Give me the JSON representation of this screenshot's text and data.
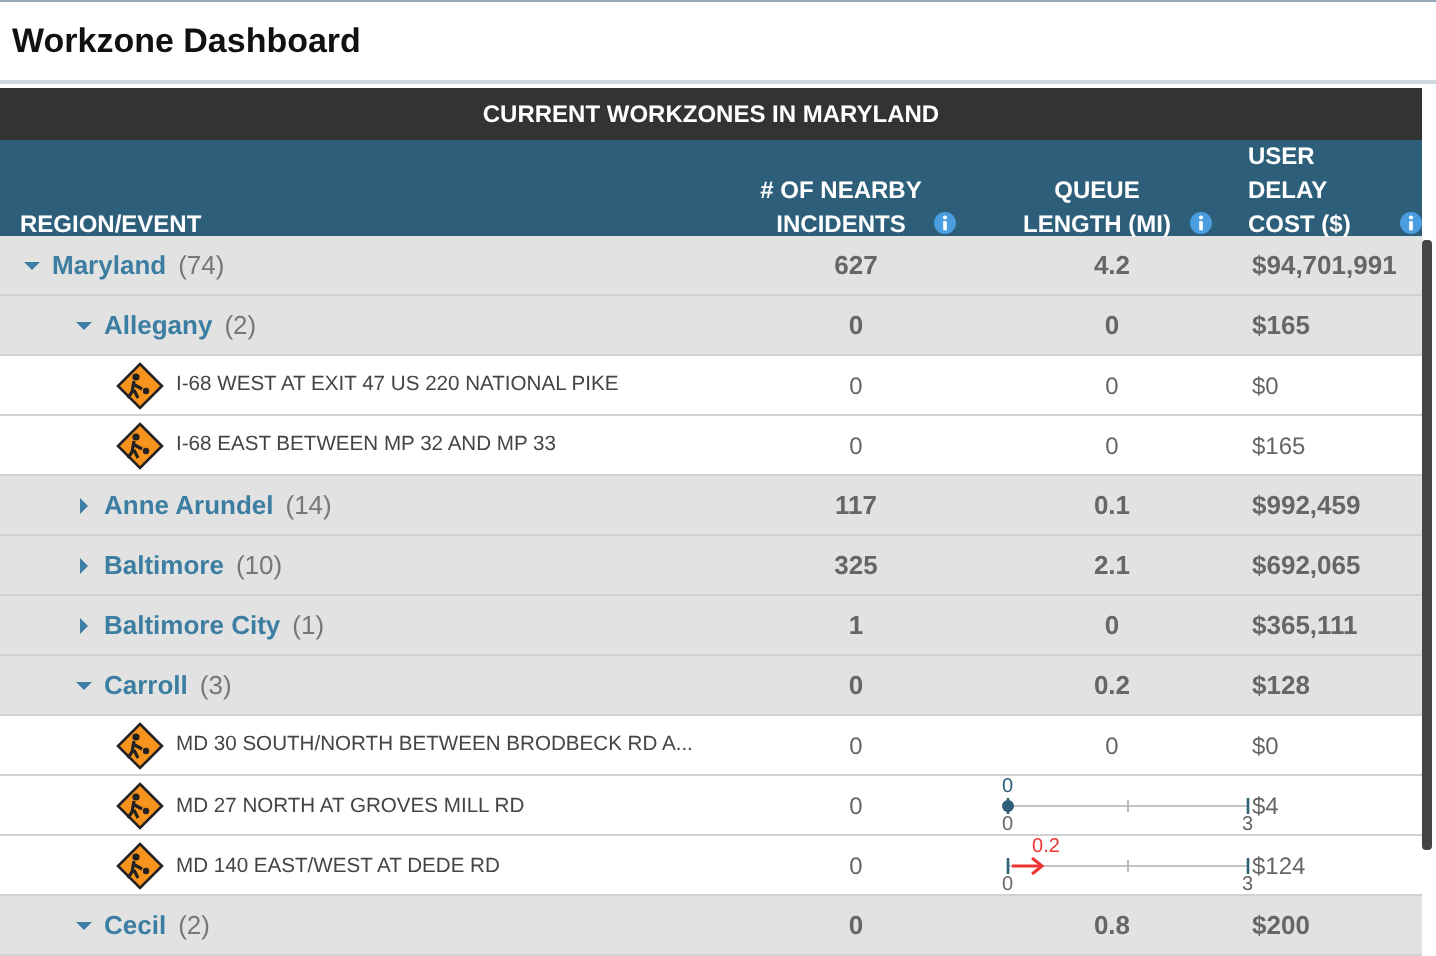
{
  "app_title": "Workzone Dashboard",
  "table": {
    "title": "CURRENT WORKZONES IN MARYLAND",
    "columns": [
      {
        "label": "REGION/EVENT",
        "info": false
      },
      {
        "label": "# OF NEARBY INCIDENTS",
        "info": true
      },
      {
        "label": "QUEUE LENGTH (MI)",
        "info": true
      },
      {
        "label": "USER DELAY COST ($)",
        "info": true
      }
    ],
    "rows": [
      {
        "kind": "region",
        "name": "Maryland",
        "count": "(74)",
        "expanded": true,
        "incidents": "627",
        "queue": {
          "kind": "text",
          "text": "4.2"
        },
        "cost": "$94,701,991",
        "children": [
          {
            "kind": "region",
            "name": "Allegany",
            "count": "(2)",
            "expanded": true,
            "incidents": "0",
            "queue": {
              "kind": "text",
              "text": "0"
            },
            "cost": "$165",
            "children": [
              {
                "kind": "event",
                "name": "I-68 WEST AT EXIT 47 US 220 NATIONAL PIKE",
                "incidents": "0",
                "queue": {
                  "kind": "text",
                  "text": "0"
                },
                "cost": "$0"
              },
              {
                "kind": "event",
                "name": "I-68 EAST BETWEEN MP 32 AND MP 33",
                "incidents": "0",
                "queue": {
                  "kind": "text",
                  "text": "0"
                },
                "cost": "$165"
              }
            ]
          },
          {
            "kind": "region",
            "name": "Anne Arundel",
            "count": "(14)",
            "expanded": false,
            "incidents": "117",
            "queue": {
              "kind": "text",
              "text": "0.1"
            },
            "cost": "$992,459"
          },
          {
            "kind": "region",
            "name": "Baltimore",
            "count": "(10)",
            "expanded": false,
            "incidents": "325",
            "queue": {
              "kind": "text",
              "text": "2.1"
            },
            "cost": "$692,065"
          },
          {
            "kind": "region",
            "name": "Baltimore City",
            "count": "(1)",
            "expanded": false,
            "incidents": "1",
            "queue": {
              "kind": "text",
              "text": "0"
            },
            "cost": "$365,111"
          },
          {
            "kind": "region",
            "name": "Carroll",
            "count": "(3)",
            "expanded": true,
            "incidents": "0",
            "queue": {
              "kind": "text",
              "text": "0.2"
            },
            "cost": "$128",
            "children": [
              {
                "kind": "event",
                "name": "MD 30 SOUTH/NORTH BETWEEN BRODBECK RD A...",
                "incidents": "0",
                "queue": {
                  "kind": "text",
                  "text": "0"
                },
                "cost": "$0"
              },
              {
                "kind": "event",
                "name": "MD 27 NORTH AT GROVES MILL RD",
                "incidents": "0",
                "queue": {
                  "kind": "dot-gauge",
                  "reading": "0",
                  "min": "0",
                  "max": "3",
                  "level": 0
                },
                "cost": "$4"
              },
              {
                "kind": "event",
                "name": "MD 140 EAST/WEST AT DEDE RD",
                "incidents": "0",
                "queue": {
                  "kind": "arrow-gauge",
                  "reading": "0.2",
                  "min": "0",
                  "max": "3",
                  "level": 0.067
                },
                "cost": "$124"
              }
            ]
          },
          {
            "kind": "region",
            "name": "Cecil",
            "count": "(2)",
            "expanded": true,
            "incidents": "0",
            "queue": {
              "kind": "text",
              "text": "0.8"
            },
            "cost": "$200"
          }
        ]
      }
    ]
  }
}
